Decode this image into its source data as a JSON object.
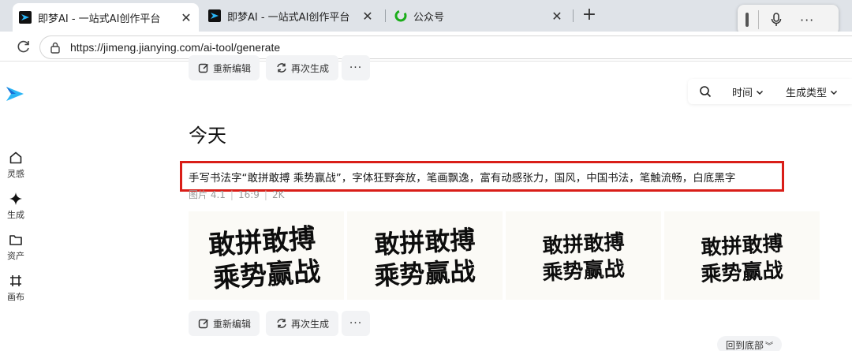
{
  "browser": {
    "tabs": [
      {
        "title": "即梦AI - 一站式AI创作平台",
        "active": true,
        "icon": "jimeng-logo-icon"
      },
      {
        "title": "即梦AI - 一站式AI创作平台",
        "active": false,
        "icon": "jimeng-logo-icon"
      },
      {
        "title": "公众号",
        "active": false,
        "icon": "wechat-icon"
      }
    ],
    "url": "https://jimeng.jianying.com/ai-tool/generate"
  },
  "sidebar": {
    "items": [
      {
        "label": "灵感",
        "icon": "home-icon"
      },
      {
        "label": "生成",
        "icon": "sparkle-icon"
      },
      {
        "label": "资产",
        "icon": "folder-icon"
      },
      {
        "label": "画布",
        "icon": "canvas-icon"
      }
    ]
  },
  "top_actions": {
    "re_edit": "重新编辑",
    "regenerate": "再次生成",
    "more": "···"
  },
  "filters": {
    "time": "时间",
    "type": "生成类型"
  },
  "section": {
    "title": "今天",
    "prompt": "手写书法字“敢拼敢搏 乘势赢战”，字体狂野奔放，笔画飘逸，富有动感张力，国风，中国书法，笔触流畅，白底黑字",
    "meta": [
      "图片 4.1",
      "16:9",
      "2K"
    ],
    "images": [
      {
        "line1": "敢拼敢搏",
        "line2": "乘势赢战"
      },
      {
        "line1": "敢拼敢搏",
        "line2": "乘势赢战"
      },
      {
        "line1": "敢拼敢搏",
        "line2": "乘势赢战"
      },
      {
        "line1": "敢拼敢搏",
        "line2": "乘势赢战"
      }
    ]
  },
  "bottom_actions": {
    "re_edit": "重新编辑",
    "regenerate": "再次生成",
    "more": "···",
    "back_to_bottom": "回到底部"
  },
  "colors": {
    "highlight": "#d91e18",
    "tabstrip": "#dfe3e8",
    "button_bg": "#f2f3f5"
  }
}
